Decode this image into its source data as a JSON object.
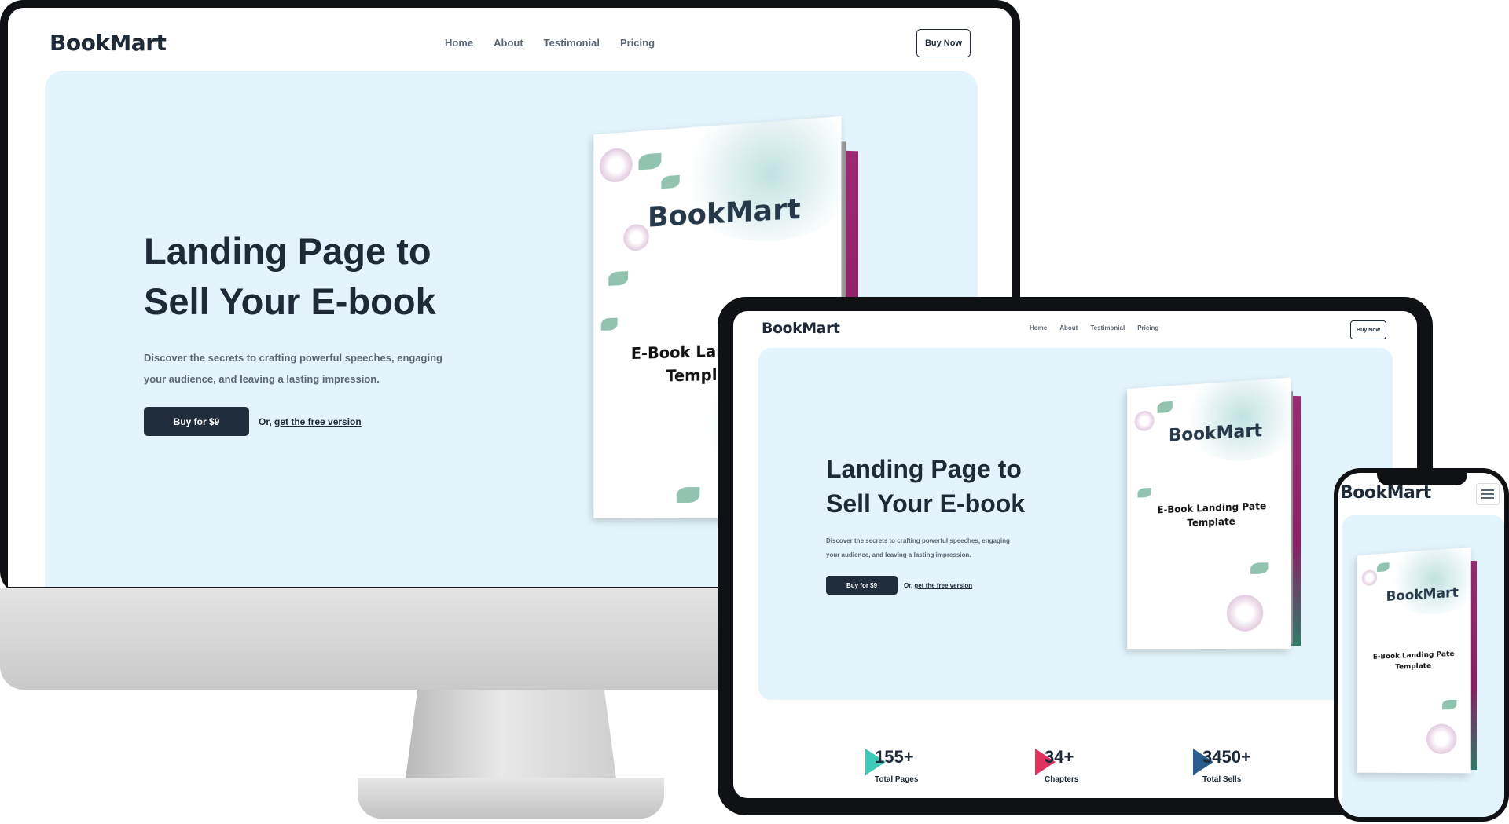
{
  "brand": {
    "name": "BookMart"
  },
  "nav": {
    "items": [
      "Home",
      "About",
      "Testimonial",
      "Pricing"
    ],
    "cta": "Buy Now"
  },
  "hero": {
    "title_line1": "Landing Page to",
    "title_line2": "Sell Your E-book",
    "desc_line1": "Discover the secrets to crafting powerful speeches, engaging",
    "desc_line2": "your audience, and leaving a lasting impression.",
    "buy_button": "Buy for $9",
    "or_prefix": "Or, ",
    "free_link": "get the free version"
  },
  "book": {
    "cover_title": "BookMart",
    "cover_sub_line1_desktop": "E-Book Land",
    "cover_sub_line2_desktop": "Templa",
    "cover_sub_line1": "E-Book Landing Pate",
    "cover_sub_line2": "Template"
  },
  "stats": [
    {
      "value": "155+",
      "label": "Total Pages",
      "color": "#3ec9b8"
    },
    {
      "value": "34+",
      "label": "Chapters",
      "color": "#e0325e"
    },
    {
      "value": "3450+",
      "label": "Total Sells",
      "color": "#2a5e8f"
    }
  ],
  "phone": {
    "menu_icon": "hamburger-menu-icon"
  },
  "colors": {
    "dark": "#1e2a38",
    "hero_bg": "#e3f4fc",
    "nav_text": "#5b6775"
  }
}
